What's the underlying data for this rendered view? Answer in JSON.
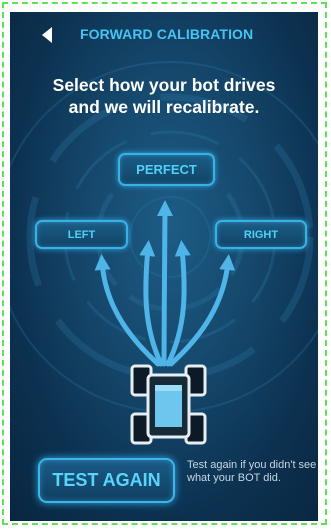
{
  "header": {
    "title": "FORWARD CALIBRATION",
    "back_icon": "back-arrow-icon"
  },
  "headline": {
    "line1": "Select how your bot drives",
    "line2": "and we will recalibrate."
  },
  "options": {
    "perfect": "PERFECT",
    "left": "LEFT",
    "right": "RIGHT"
  },
  "robot_icon": "robot-top-view-icon",
  "actions": {
    "test_again_label": "TEST AGAIN",
    "hint": "Test again if you didn't see what your BOT did."
  },
  "colors": {
    "accent": "#45c4f4",
    "arrow": "#4fb4e8",
    "border_highlight": "#5fe05a",
    "background": "#0f3b5c"
  }
}
